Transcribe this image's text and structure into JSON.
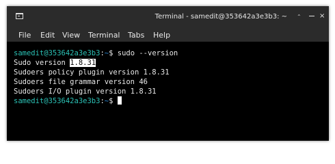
{
  "window": {
    "title": "Terminal - samedit@353642a3e3b3: ~",
    "title_chevron": "⌃",
    "close_glyph": "×"
  },
  "icons": {
    "app": "terminal-icon",
    "minimize": "minimize-icon",
    "close": "close-icon"
  },
  "menu": [
    "File",
    "Edit",
    "View",
    "Terminal",
    "Tabs",
    "Help"
  ],
  "prompt": {
    "user_host": "samedit@353642a3e3b3",
    "separator": ":",
    "path": "~",
    "symbol": "$"
  },
  "command": " sudo --version",
  "output": {
    "line1_prefix": "Sudo version ",
    "line1_highlight": "1.8.31",
    "line2": "Sudoers policy plugin version 1.8.31",
    "line3": "Sudoers file grammar version 46",
    "line4": "Sudoers I/O plugin version 1.8.31"
  },
  "colors": {
    "background": "#000000",
    "titlebar": "#2b2b2b",
    "prompt_user": "#2bc2b6",
    "prompt_path": "#2b8bd8",
    "text": "#e8e8e8"
  }
}
